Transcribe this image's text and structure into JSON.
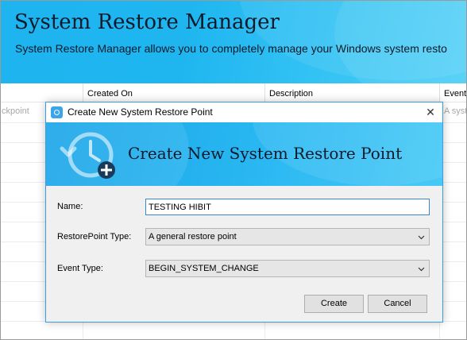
{
  "app": {
    "title": "System Restore Manager",
    "subtitle": "System Restore Manager allows you to completely manage your Windows system resto",
    "columns": [
      "",
      "Created On",
      "Description",
      "Event"
    ],
    "faded_row": {
      "col0": "ckpoint",
      "col3": "A syst"
    }
  },
  "dialog": {
    "title": "Create New System Restore Point",
    "close_glyph": "✕",
    "heading": "Create New System Restore Point",
    "name_label": "Name:",
    "name_value": "TESTING HIBIT",
    "restore_type_label": "RestorePoint Type:",
    "restore_type_value": "A general restore point",
    "event_type_label": "Event Type:",
    "event_type_value": "BEGIN_SYSTEM_CHANGE",
    "create_label": "Create",
    "cancel_label": "Cancel"
  },
  "icons": {
    "app_icon": "restore-app-icon",
    "banner_icon": "restore-clock-plus-icon",
    "chevron": "chevron-down-icon",
    "close": "close-icon"
  },
  "colors": {
    "banner_blue": "#1db4ef",
    "focus_border": "#3b86d1",
    "dialog_border": "#3d9be0"
  }
}
